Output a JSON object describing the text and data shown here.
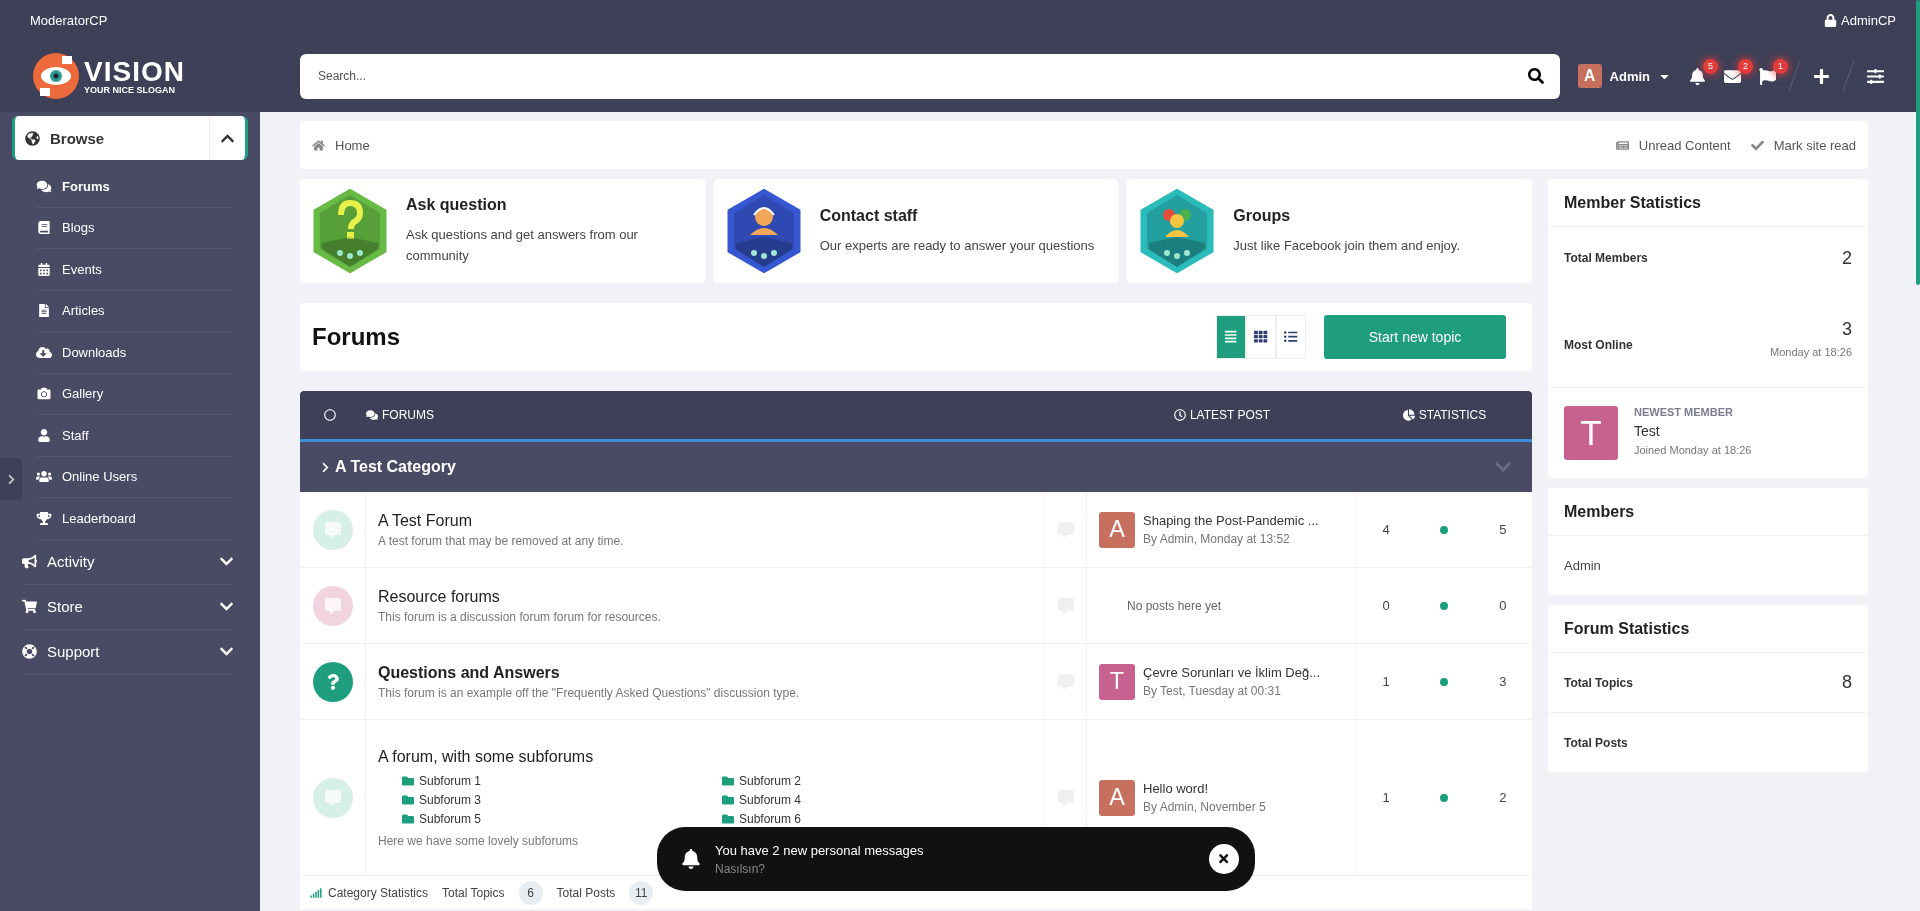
{
  "top_bar": {
    "left_link": "ModeratorCP",
    "right_link": "AdminCP"
  },
  "logo": {
    "name": "VISION",
    "slogan": "YOUR NICE SLOGAN"
  },
  "search": {
    "placeholder": "Search..."
  },
  "user_menu": {
    "avatar_letter": "A",
    "name": "Admin"
  },
  "alerts": [
    {
      "kind": "bell",
      "count": "5"
    },
    {
      "kind": "mail",
      "count": "2"
    },
    {
      "kind": "flag",
      "count": "1"
    }
  ],
  "sidebar": {
    "sections": [
      {
        "label": "Browse",
        "kind": "globe",
        "expanded": true,
        "children": [
          {
            "label": "Forums",
            "kind": "comments",
            "selected": true
          },
          {
            "label": "Blogs",
            "kind": "book",
            "selected": false
          },
          {
            "label": "Events",
            "kind": "calendar",
            "selected": false
          },
          {
            "label": "Articles",
            "kind": "file",
            "selected": false
          },
          {
            "label": "Downloads",
            "kind": "cloud",
            "selected": false
          },
          {
            "label": "Gallery",
            "kind": "camera",
            "selected": false
          },
          {
            "label": "Staff",
            "kind": "user",
            "selected": false
          },
          {
            "label": "Online Users",
            "kind": "users",
            "selected": false
          },
          {
            "label": "Leaderboard",
            "kind": "trophy",
            "selected": false
          }
        ]
      },
      {
        "label": "Activity",
        "kind": "bullhorn",
        "expanded": false
      },
      {
        "label": "Store",
        "kind": "cart",
        "expanded": false
      },
      {
        "label": "Support",
        "kind": "lifering",
        "expanded": false
      }
    ]
  },
  "breadcrumb": {
    "items": [
      "Home"
    ],
    "actions": [
      {
        "kind": "unread",
        "label": "Unread Content"
      },
      {
        "kind": "check",
        "label": "Mark site read"
      }
    ]
  },
  "feature_cards": [
    {
      "kind": "question",
      "title": "Ask question",
      "text": "Ask questions and get answers from our community",
      "color": "#5fb83a"
    },
    {
      "kind": "staff",
      "title": "Contact staff",
      "text": "Our experts are ready to answer your questions",
      "color": "#2d4fd0"
    },
    {
      "kind": "groups",
      "title": "Groups",
      "text": "Just like Facebook join them and enjoy.",
      "color": "#1fb8b8"
    }
  ],
  "page_title": "Forums",
  "view_modes": [
    {
      "kind": "list",
      "selected": true
    },
    {
      "kind": "grid",
      "selected": false
    },
    {
      "kind": "table",
      "selected": false
    }
  ],
  "start_button": "Start new topic",
  "table": {
    "columns": [
      {
        "kind": "circle"
      },
      {
        "kind": "comments",
        "label": "FORUMS"
      },
      {
        "kind": "clock",
        "label": "LATEST POST"
      },
      {
        "kind": "pie",
        "label": "STATISTICS"
      }
    ],
    "category": {
      "title": "A Test Category",
      "expanded": false
    },
    "rows": [
      {
        "kind": "forum",
        "color": "#d6efe8",
        "title": "A Test Forum",
        "title_bold": false,
        "description": "A test forum that may be removed at any time.",
        "latest": {
          "avatar": "A",
          "color": "#c7705f",
          "title": "Shaping the Post-Pandemic ...",
          "meta": "By Admin, Monday at 13:52"
        },
        "threads": "4",
        "messages": "5"
      },
      {
        "kind": "forum",
        "color": "#f2d3e0",
        "title": "Resource forums",
        "title_bold": false,
        "description": "This forum is a discussion forum forum for resources.",
        "empty_text": "No posts here yet",
        "threads": "0",
        "messages": "0"
      },
      {
        "kind": "question",
        "color": "#1e9e7e",
        "title": "Questions and Answers",
        "title_bold": true,
        "description": "This forum is an example off the \"Frequently Asked Questions\" discussion type.",
        "latest": {
          "avatar": "T",
          "color": "#c7618f",
          "title": "Çevre Sorunları ve İklim Değ...",
          "meta": "By Test, Tuesday at 00:31"
        },
        "threads": "1",
        "messages": "3"
      },
      {
        "kind": "forum",
        "color": "#d6efe8",
        "title": "A forum, with some subforums",
        "title_bold": false,
        "subforums": [
          "Subforum 1",
          "Subforum 2",
          "Subforum 3",
          "Subforum 4",
          "Subforum 5",
          "Subforum 6"
        ],
        "description": "Here we have some lovely subforums",
        "latest": {
          "avatar": "A",
          "color": "#c7705f",
          "title": "Hello word!",
          "meta": "By Admin, November 5"
        },
        "threads": "1",
        "messages": "2"
      }
    ],
    "footer": {
      "label": "Category Statistics",
      "stats": [
        {
          "label": "Total Topics",
          "value": "6"
        },
        {
          "label": "Total Posts",
          "value": "11"
        }
      ]
    }
  },
  "toast": {
    "title": "You have 2 new personal messages",
    "text": "Nasılsın?"
  },
  "member_stats": {
    "title": "Member Statistics",
    "rows": [
      {
        "label": "Total Members",
        "value": "2"
      },
      {
        "label": "Most Online",
        "value": "3",
        "sub": "Monday at 18:26"
      }
    ],
    "newest": {
      "avatar": "T",
      "color": "#c7618f",
      "label": "NEWEST MEMBER",
      "name": "Test",
      "joined": "Joined Monday at 18:26"
    }
  },
  "members": {
    "title": "Members",
    "names": [
      "Admin"
    ]
  },
  "forum_stats": {
    "title": "Forum Statistics",
    "rows": [
      {
        "label": "Total Topics",
        "value": "8"
      },
      {
        "label": "Total Posts"
      }
    ]
  }
}
